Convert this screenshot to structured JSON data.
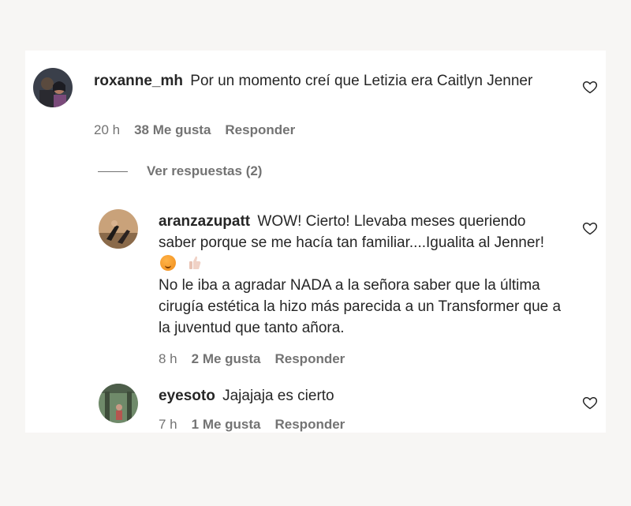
{
  "comments": [
    {
      "username": "roxanne_mh",
      "text": "Por un momento creí que Letizia era Caitlyn Jenner",
      "time": "20 h",
      "likes": "38 Me gusta",
      "reply": "Responder",
      "icons": {
        "like": "heart-outline-icon"
      }
    },
    {
      "username": "aranzazupatt",
      "text_line1": "WOW! Cierto! Llevaba meses queriendo saber porque se me hacía tan familiar....Igualita al Jenner!",
      "text_line2": "No le iba a agradar NADA a la señora saber que la última cirugía estética la hizo más parecida a un Transformer que a la juventud que tanto añora.",
      "time": "8 h",
      "likes": "2 Me gusta",
      "reply": "Responder",
      "icons": {
        "emoji1": "hand-over-mouth-emoji",
        "emoji2": "thumbs-up-emoji",
        "like": "heart-outline-icon"
      }
    },
    {
      "username": "eyesoto",
      "text": "Jajajaja es cierto",
      "time": "7 h",
      "likes": "1 Me gusta",
      "reply": "Responder",
      "icons": {
        "like": "heart-outline-icon"
      }
    }
  ],
  "view_replies": "Ver respuestas (2)",
  "colors": {
    "text": "#262626",
    "muted": "#737373",
    "background": "#f7f6f4",
    "panel": "#ffffff"
  }
}
